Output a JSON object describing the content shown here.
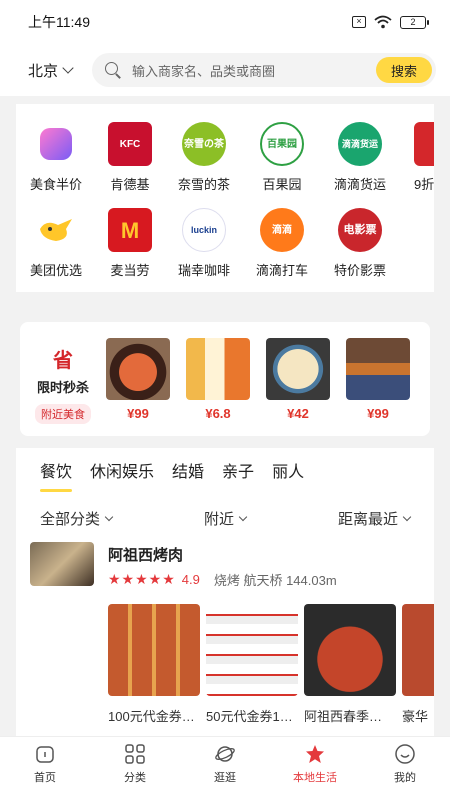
{
  "status_bar": {
    "time": "上午11:49",
    "battery": "2"
  },
  "header": {
    "city": "北京",
    "search_placeholder": "输入商家名、品类或商圈",
    "search_button": "搜索"
  },
  "categories": [
    {
      "label": "美食半价",
      "icon": "food-half-price-icon",
      "color": "#9a5cf5",
      "badge": ""
    },
    {
      "label": "肯德基",
      "icon": "kfc-icon",
      "color": "#c8102e",
      "badge": "KFC"
    },
    {
      "label": "奈雪的茶",
      "icon": "nayuki-icon",
      "color": "#8cbf26",
      "badge": "奈雪の茶"
    },
    {
      "label": "百果园",
      "icon": "pagoda-icon",
      "color": "#2ea043",
      "badge": "百果园"
    },
    {
      "label": "滴滴货运",
      "icon": "didi-freight-icon",
      "color": "#1aa56e",
      "badge": "滴滴货运"
    },
    {
      "label": "9折",
      "icon": "discount-icon",
      "color": "#d4272b",
      "badge": ""
    },
    {
      "label": "美团优选",
      "icon": "meituan-select-icon",
      "color": "#ffc629",
      "badge": ""
    },
    {
      "label": "麦当劳",
      "icon": "mcdonalds-icon",
      "color": "#d71920",
      "badge": "M"
    },
    {
      "label": "瑞幸咖啡",
      "icon": "luckin-icon",
      "color": "#1a3f8f",
      "badge": "luckin"
    },
    {
      "label": "滴滴打车",
      "icon": "didi-taxi-icon",
      "color": "#ff7a1a",
      "badge": "滴滴"
    },
    {
      "label": "特价影票",
      "icon": "movie-ticket-icon",
      "color": "#c9262c",
      "badge": "电影票"
    }
  ],
  "flash_sale": {
    "title_char": "省",
    "title": "限时秒杀",
    "tag": "附近美食",
    "items": [
      {
        "price": "¥99",
        "color": "#7a3b22"
      },
      {
        "price": "¥6.8",
        "color": "#e0a23a"
      },
      {
        "price": "¥42",
        "color": "#c69a5c"
      },
      {
        "price": "¥99",
        "color": "#5a3d2e"
      }
    ]
  },
  "listing": {
    "tabs": [
      "餐饮",
      "休闲娱乐",
      "结婚",
      "亲子",
      "丽人"
    ],
    "filters": [
      "全部分类",
      "附近",
      "距离最近"
    ],
    "shop": {
      "name": "阿祖西烤肉",
      "stars": "★★★★★",
      "rating": "4.9",
      "sub": "烧烤 航天桥 144.03m"
    },
    "deals": [
      {
        "text": "100元代金券…",
        "color": "#b5452a"
      },
      {
        "text": "50元代金券1…",
        "color": "#ececec"
      },
      {
        "text": "阿祖西春季…",
        "color": "#a13a22"
      },
      {
        "text": "豪华",
        "color": "#b94a2e"
      }
    ]
  },
  "nav": [
    {
      "label": "首页",
      "icon": "home-icon"
    },
    {
      "label": "分类",
      "icon": "category-grid-icon"
    },
    {
      "label": "逛逛",
      "icon": "planet-icon"
    },
    {
      "label": "本地生活",
      "icon": "local-life-star-icon",
      "active": true
    },
    {
      "label": "我的",
      "icon": "profile-icon"
    }
  ]
}
